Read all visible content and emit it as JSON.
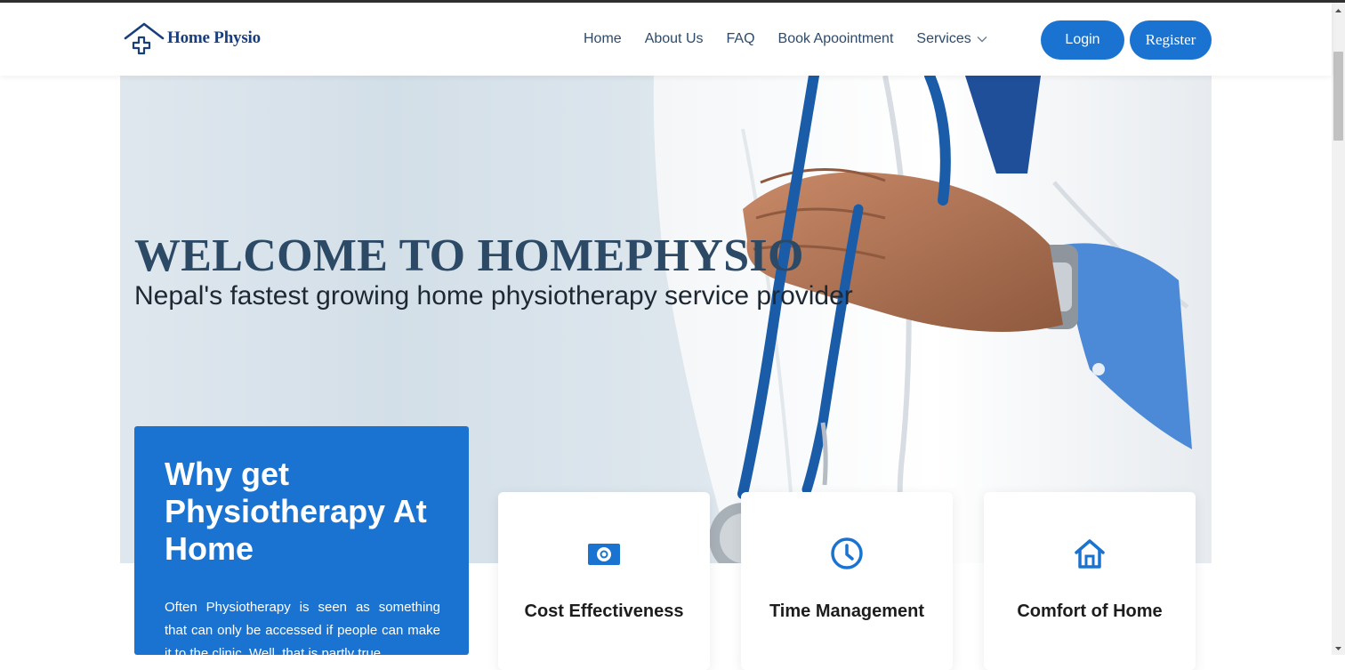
{
  "brand": {
    "name": "Home Physio",
    "logo_icon": "house-with-cross-icon"
  },
  "nav": {
    "links": [
      "Home",
      "About Us",
      "FAQ",
      "Book Apoointment"
    ],
    "services_label": "Services"
  },
  "auth": {
    "login_label": "Login",
    "register_label": "Register"
  },
  "hero": {
    "title": "WELCOME TO HOMEPHYSIO",
    "subtitle": "Nepal's fastest growing home physiotherapy service provider"
  },
  "why": {
    "title": "Why get Physiotherapy At Home",
    "text": "Often Physiotherapy is seen as something that can only be accessed if people can make it to the clinic. Well, that is partly true."
  },
  "features": [
    {
      "title": "Cost Effectiveness",
      "icon": "money-icon"
    },
    {
      "title": "Time Management",
      "icon": "clock-icon"
    },
    {
      "title": "Comfort of Home",
      "icon": "home-icon"
    }
  ],
  "colors": {
    "primary": "#1a73d0",
    "brand_text": "#1a3d7c",
    "hero_title": "#2c4a66"
  }
}
